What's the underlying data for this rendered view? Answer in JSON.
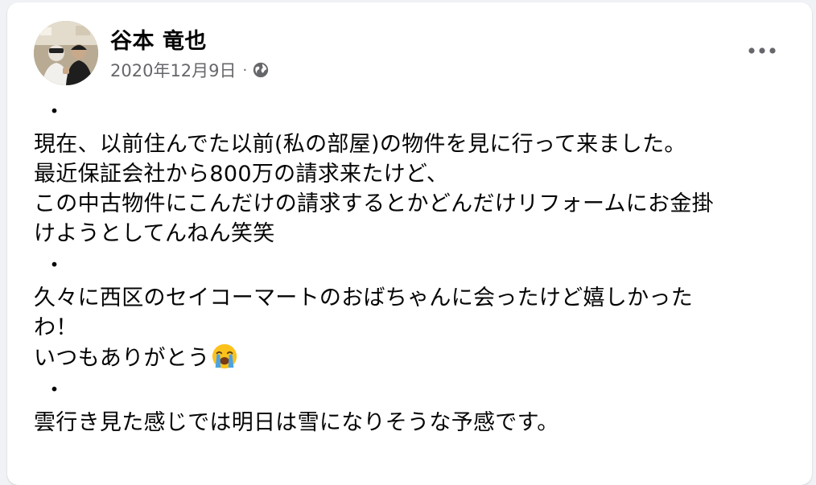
{
  "post": {
    "author": "谷本 竜也",
    "date": "2020年12月9日",
    "dot": "·",
    "privacy_icon": "globe-icon",
    "more_icon": "more-options-icon"
  },
  "content": {
    "sep": "・",
    "p1": [
      "現在、以前住んでた以前(私の部屋)の物件を見に行って来ました。",
      "最近保証会社から800万の請求来たけど、",
      "この中古物件にこんだけの請求するとかどんだけリフォームにお金掛",
      "けようとしてんねん笑笑"
    ],
    "p2": [
      "久々に西区のセイコーマートのおばちゃんに会ったけど嬉しかった",
      "わ！",
      "いつもありがとう"
    ],
    "p2_emoji": "loudly-crying-face-emoji",
    "p3": [
      "雲行き見た感じでは明日は雪になりそうな予感です。"
    ]
  },
  "colors": {
    "text": "#050505",
    "secondary": "#65676b",
    "background": "#f0f2f5",
    "card": "#ffffff"
  }
}
